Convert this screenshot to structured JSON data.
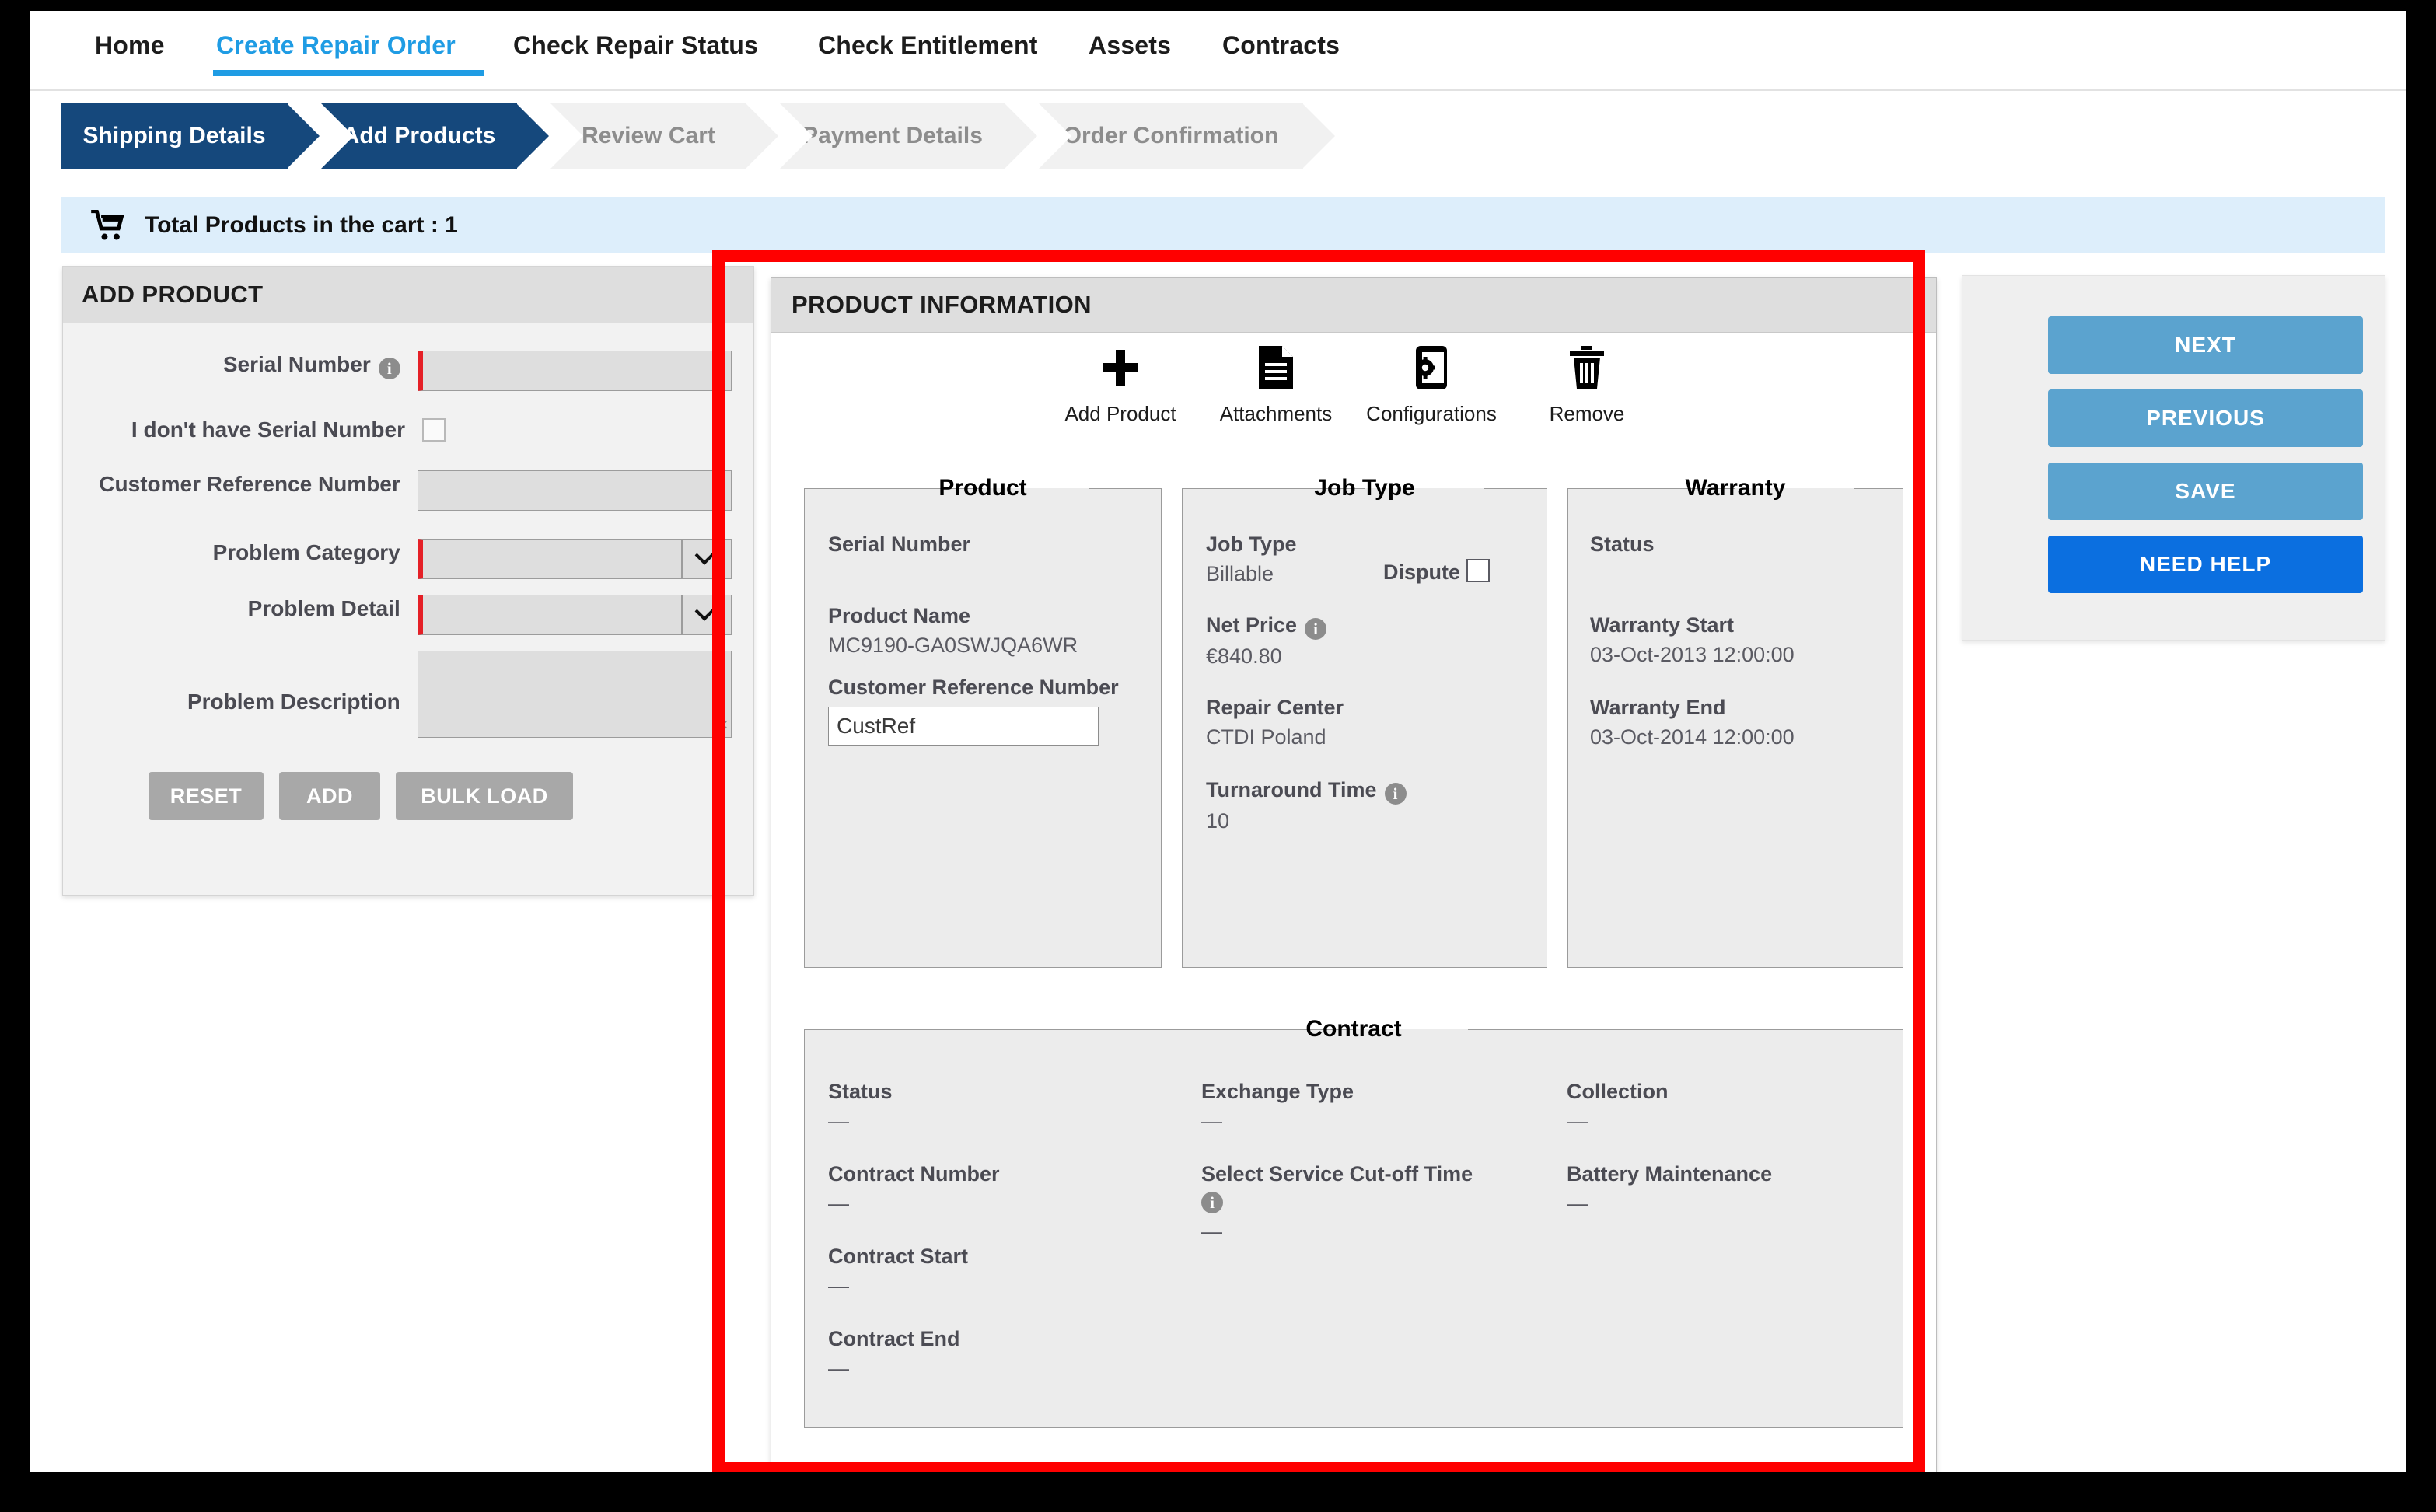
{
  "nav": {
    "items": [
      {
        "label": "Home",
        "active": false
      },
      {
        "label": "Create Repair Order",
        "active": true
      },
      {
        "label": "Check Repair Status",
        "active": false
      },
      {
        "label": "Check Entitlement",
        "active": false
      },
      {
        "label": "Assets",
        "active": false
      },
      {
        "label": "Contracts",
        "active": false
      }
    ]
  },
  "steps": [
    {
      "label": "Shipping Details",
      "state": "done"
    },
    {
      "label": "Add Products",
      "state": "done"
    },
    {
      "label": "Review Cart",
      "state": "todo"
    },
    {
      "label": "Payment Details",
      "state": "todo"
    },
    {
      "label": "Order Confirmation",
      "state": "todo"
    }
  ],
  "cart": {
    "icon": "shopping-cart-icon",
    "text": "Total Products in the cart : 1"
  },
  "add_product": {
    "title": "ADD PRODUCT",
    "fields": {
      "serial_number_label": "Serial Number",
      "serial_number_value": "",
      "no_serial_label": "I don't have Serial Number",
      "no_serial_checked": false,
      "customer_ref_label": "Customer Reference Number",
      "customer_ref_value": "",
      "problem_category_label": "Problem Category",
      "problem_category_value": "",
      "problem_detail_label": "Problem Detail",
      "problem_detail_value": "",
      "problem_description_label": "Problem Description",
      "problem_description_value": ""
    },
    "buttons": {
      "reset": "RESET",
      "add": "ADD",
      "bulk_load": "BULK LOAD"
    }
  },
  "product_information": {
    "title": "PRODUCT INFORMATION",
    "toolbar": [
      {
        "label": "Add Product",
        "icon": "plus-icon"
      },
      {
        "label": "Attachments",
        "icon": "document-icon"
      },
      {
        "label": "Configurations",
        "icon": "device-gear-icon"
      },
      {
        "label": "Remove",
        "icon": "trash-icon"
      }
    ],
    "product": {
      "legend": "Product",
      "serial_number_label": "Serial Number",
      "serial_number_value": "",
      "product_name_label": "Product Name",
      "product_name_value": "MC9190-GA0SWJQA6WR",
      "customer_ref_label": "Customer Reference Number",
      "customer_ref_value": "CustRef"
    },
    "job_type": {
      "legend": "Job Type",
      "job_type_label": "Job Type",
      "job_type_value": "Billable",
      "dispute_label": "Dispute",
      "dispute_checked": false,
      "net_price_label": "Net Price",
      "net_price_value": "€840.80",
      "repair_center_label": "Repair Center",
      "repair_center_value": "CTDI Poland",
      "turnaround_label": "Turnaround Time",
      "turnaround_value": "10"
    },
    "warranty": {
      "legend": "Warranty",
      "status_label": "Status",
      "status_value": "",
      "start_label": "Warranty Start",
      "start_value": "03-Oct-2013 12:00:00",
      "end_label": "Warranty End",
      "end_value": "03-Oct-2014 12:00:00"
    },
    "contract": {
      "legend": "Contract",
      "status_label": "Status",
      "status_value": "—",
      "contract_number_label": "Contract Number",
      "contract_number_value": "—",
      "contract_start_label": "Contract Start",
      "contract_start_value": "—",
      "contract_end_label": "Contract End",
      "contract_end_value": "—",
      "exchange_type_label": "Exchange Type",
      "exchange_type_value": "—",
      "cutoff_label": "Select Service Cut-off Time",
      "cutoff_value": "—",
      "collection_label": "Collection",
      "collection_value": "—",
      "battery_label": "Battery Maintenance",
      "battery_value": "—"
    }
  },
  "actions": {
    "next": "NEXT",
    "previous": "PREVIOUS",
    "save": "SAVE",
    "need_help": "NEED HELP"
  },
  "colors": {
    "accent_blue": "#1f9ce4",
    "step_active": "#15487c",
    "action_blue": "#5ba3cf",
    "help_blue": "#0b6fe0",
    "required_red": "#e52027",
    "highlight_red": "#ff0000"
  }
}
